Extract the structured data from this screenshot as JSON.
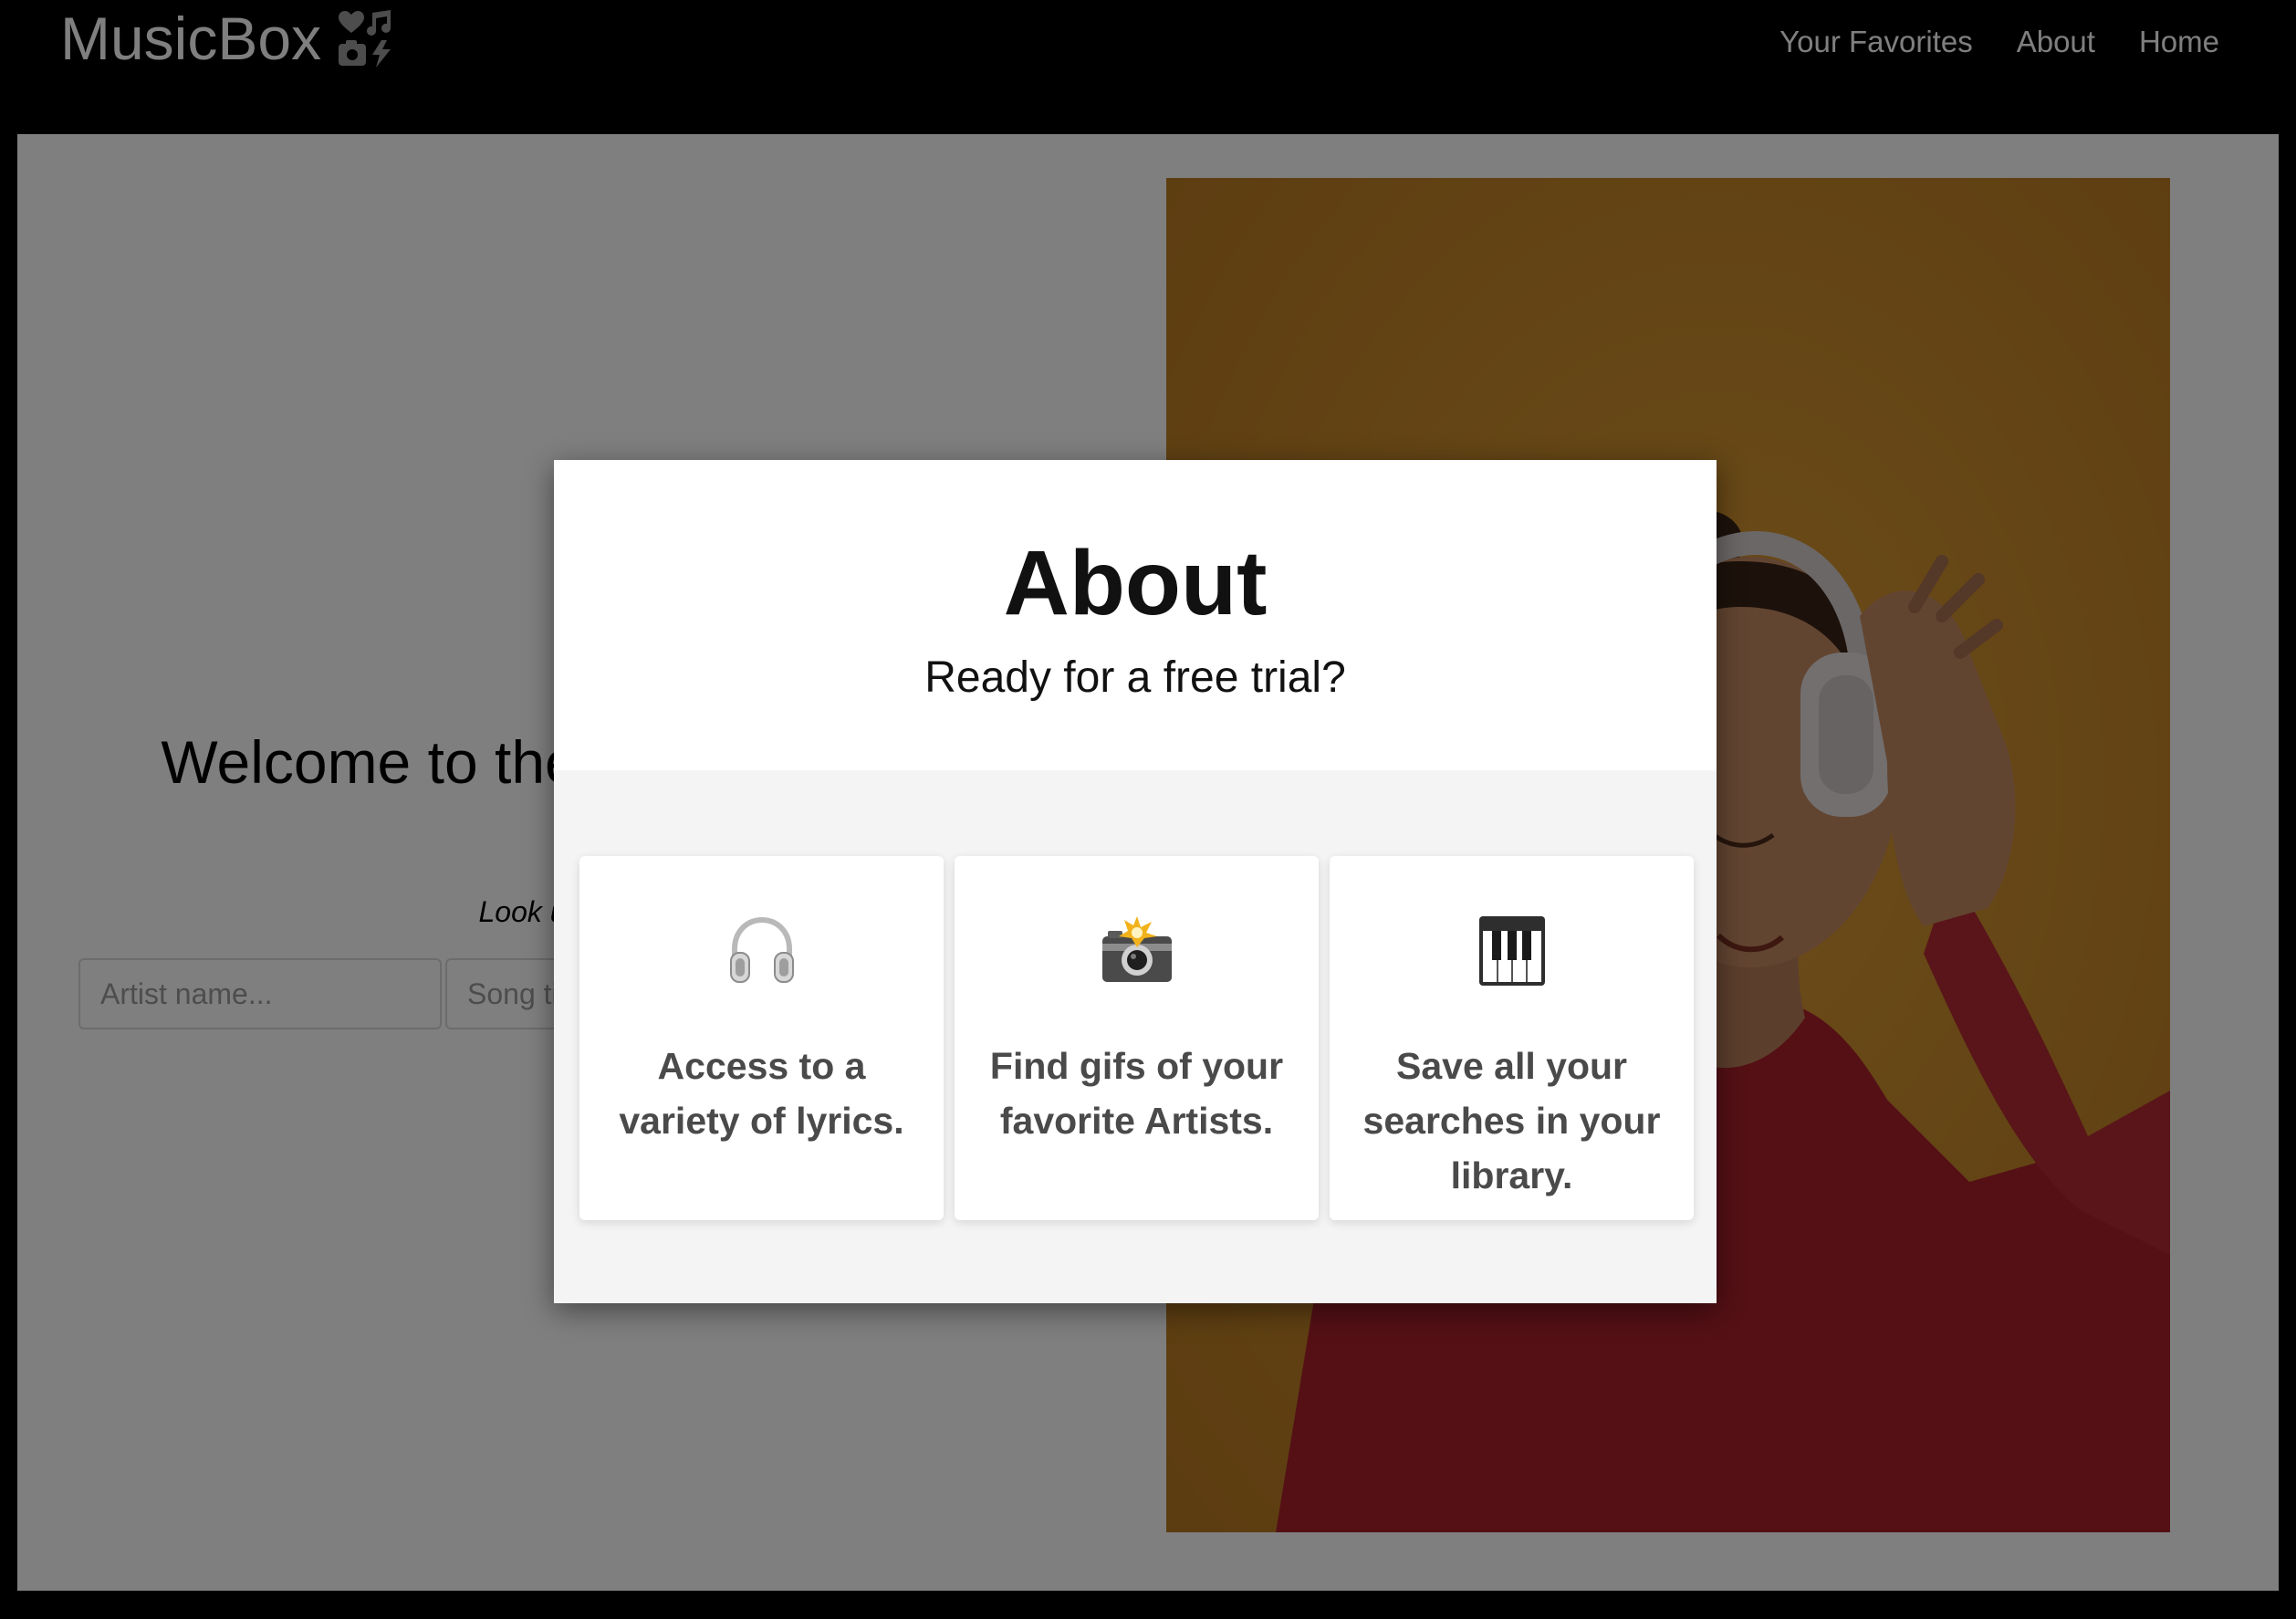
{
  "nav": {
    "brand": "MusicBox",
    "brand_icon": "music-shapes-icon",
    "links": [
      "Your Favorites",
      "About",
      "Home"
    ]
  },
  "hero": {
    "title": "Welcome to the lyrics enthusiast",
    "subtitle": "Look up the lyrics",
    "artist_placeholder": "Artist name...",
    "song_placeholder": "Song title...",
    "image": "woman-with-headphones"
  },
  "modal": {
    "title": "About",
    "subtitle": "Ready for a free trial?",
    "cards": [
      {
        "icon": "headphones-icon",
        "text": "Access to a variety of lyrics."
      },
      {
        "icon": "camera-flash-icon",
        "text": "Find gifs of your favorite Artists."
      },
      {
        "icon": "piano-keys-icon",
        "text": "Save all your searches in your library."
      }
    ]
  },
  "colors": {
    "background": "#000000",
    "hero_bg": "#c88a2a",
    "sweater": "#a8202a",
    "card_text": "#4a4a4a"
  }
}
